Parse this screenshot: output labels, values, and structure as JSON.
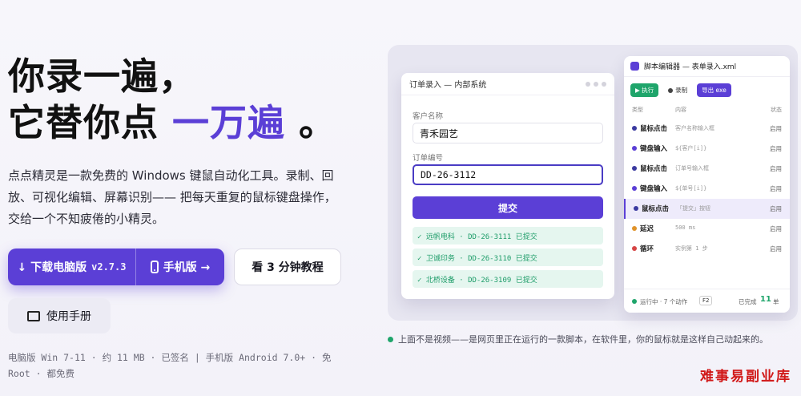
{
  "hero": {
    "line1": "你录一遍，",
    "line2_prefix": "它替你点",
    "line2_accent": "一万遍",
    "line2_suffix": "。",
    "description": "点点精灵是一款免费的 Windows 键鼠自动化工具。录制、回放、可视化编辑、屏幕识别—— 把每天重复的鼠标键盘操作，交给一个不知疲倦的小精灵。"
  },
  "buttons": {
    "download_label": "↓ 下载电脑版",
    "download_version": "v2.7.3",
    "mobile_label": "手机版 →",
    "tutorial_label": "看 3 分钟教程",
    "manual_label": "使用手册"
  },
  "meta": {
    "text": "电脑版 Win 7-11 · 约 11 MB · 已签名  |  手机版 Android 7.0+ · 免 Root · 都免费"
  },
  "app_window": {
    "title": "订单录入 — 内部系统",
    "customer_label": "客户名称",
    "customer_value": "青禾园艺",
    "order_label": "订单编号",
    "order_value": "DD-26-3112",
    "submit_label": "提交",
    "records": [
      "✓ 远帆电科 · DD-26-3111 已提交",
      "✓ 卫诚印务 · DD-26-3110 已提交",
      "✓ 北桥设备 · DD-26-3109 已提交"
    ]
  },
  "editor": {
    "title": "脚本编辑器 — 表单录入.xml",
    "run_label": "▶ 执行",
    "record_label": "录制",
    "export_label": "导出 exe",
    "col_type": "类型",
    "col_content": "内容",
    "col_state": "状态",
    "steps": [
      {
        "name": "鼠标点击",
        "detail": "客户名称输入框",
        "state": "启用",
        "color": "#3b3aa0"
      },
      {
        "name": "键盘输入",
        "detail": "${客户[i]}",
        "state": "启用",
        "color": "#5b3fd6"
      },
      {
        "name": "鼠标点击",
        "detail": "订单号输入框",
        "state": "启用",
        "color": "#3b3aa0"
      },
      {
        "name": "键盘输入",
        "detail": "${单号[i]}",
        "state": "启用",
        "color": "#5b3fd6"
      },
      {
        "name": "鼠标点击",
        "detail": "「提交」按钮",
        "state": "启用",
        "color": "#3b3aa0"
      },
      {
        "name": "延迟",
        "detail": "500 ms",
        "state": "启用",
        "color": "#e0932a"
      },
      {
        "name": "循环",
        "detail": "实例第 1 步",
        "state": "启用",
        "color": "#d64545"
      }
    ],
    "status": "运行中 · 7 个动作",
    "hotkey": "F2",
    "done_label": "已完成",
    "done_count": "11",
    "done_unit": "单"
  },
  "caption": "上面不是视频——是网页里正在运行的一款脚本，在软件里，你的鼠标就是这样自己动起来的。",
  "watermark": "难事易副业库"
}
